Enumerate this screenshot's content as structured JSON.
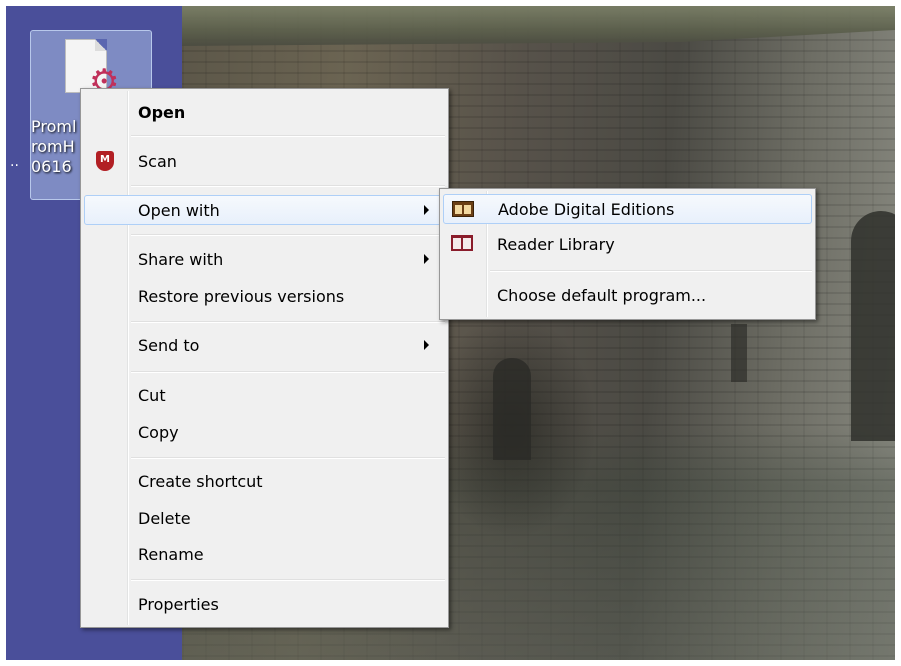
{
  "desktop": {
    "icon_label_lines": [
      "Proml",
      "romH",
      "0616"
    ],
    "icon_left_fragment": ".."
  },
  "context_menu": {
    "items": [
      {
        "label": "Open",
        "bold": true
      },
      {
        "label": "Scan",
        "icon": "mcafee-icon"
      },
      {
        "label": "Open with",
        "submenu": true,
        "highlighted": true
      },
      {
        "label": "Share with",
        "submenu": true
      },
      {
        "label": "Restore previous versions"
      },
      {
        "label": "Send to",
        "submenu": true
      },
      {
        "label": "Cut"
      },
      {
        "label": "Copy"
      },
      {
        "label": "Create shortcut"
      },
      {
        "label": "Delete"
      },
      {
        "label": "Rename"
      },
      {
        "label": "Properties"
      }
    ]
  },
  "open_with_submenu": {
    "items": [
      {
        "label": "Adobe Digital Editions",
        "icon": "adobe-digital-editions-icon",
        "highlighted": true
      },
      {
        "label": "Reader Library",
        "icon": "reader-library-icon"
      },
      {
        "label": "Choose default program..."
      }
    ]
  },
  "icons": {
    "mcafee_glyph": "M"
  },
  "colors": {
    "desktop_background": "#4a4f9a",
    "menu_background": "#f0f0f0",
    "highlight_border": "#aecff7",
    "mcafee_red": "#b21f24"
  }
}
